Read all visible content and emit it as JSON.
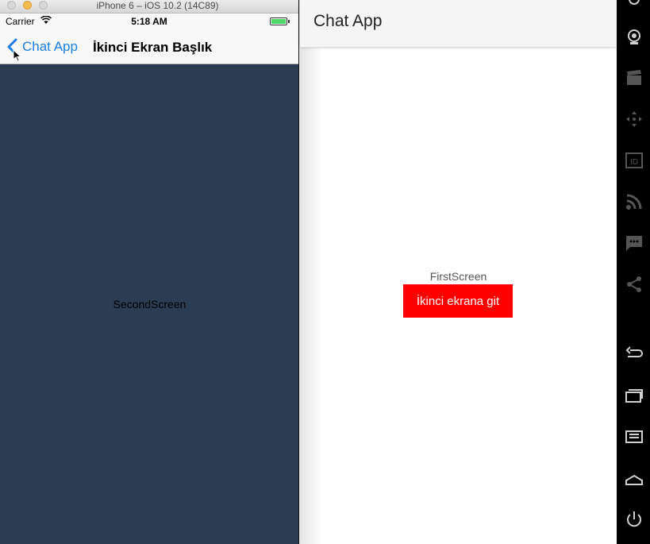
{
  "ios": {
    "window_title": "iPhone 6 – iOS 10.2 (14C89)",
    "status": {
      "carrier": "Carrier",
      "time": "5:18 AM"
    },
    "nav": {
      "back_label": "Chat App",
      "title": "İkinci Ekran Başlık"
    },
    "content_label": "SecondScreen",
    "colors": {
      "background": "#2b3d52",
      "tint": "#1a7fe0"
    }
  },
  "android": {
    "app_title": "Chat App",
    "first_screen_label": "FirstScreen",
    "button_label": "İkinci ekrana git",
    "colors": {
      "button": "#ff0000",
      "appbar": "#f5f5f5"
    }
  },
  "emulator_toolbar": {
    "icons": [
      "camera-icon",
      "video-icon",
      "dpad-icon",
      "id-icon",
      "rss-icon",
      "message-icon",
      "share-icon",
      "back-icon",
      "recents-icon",
      "menu-icon",
      "home-icon",
      "power-icon"
    ]
  }
}
